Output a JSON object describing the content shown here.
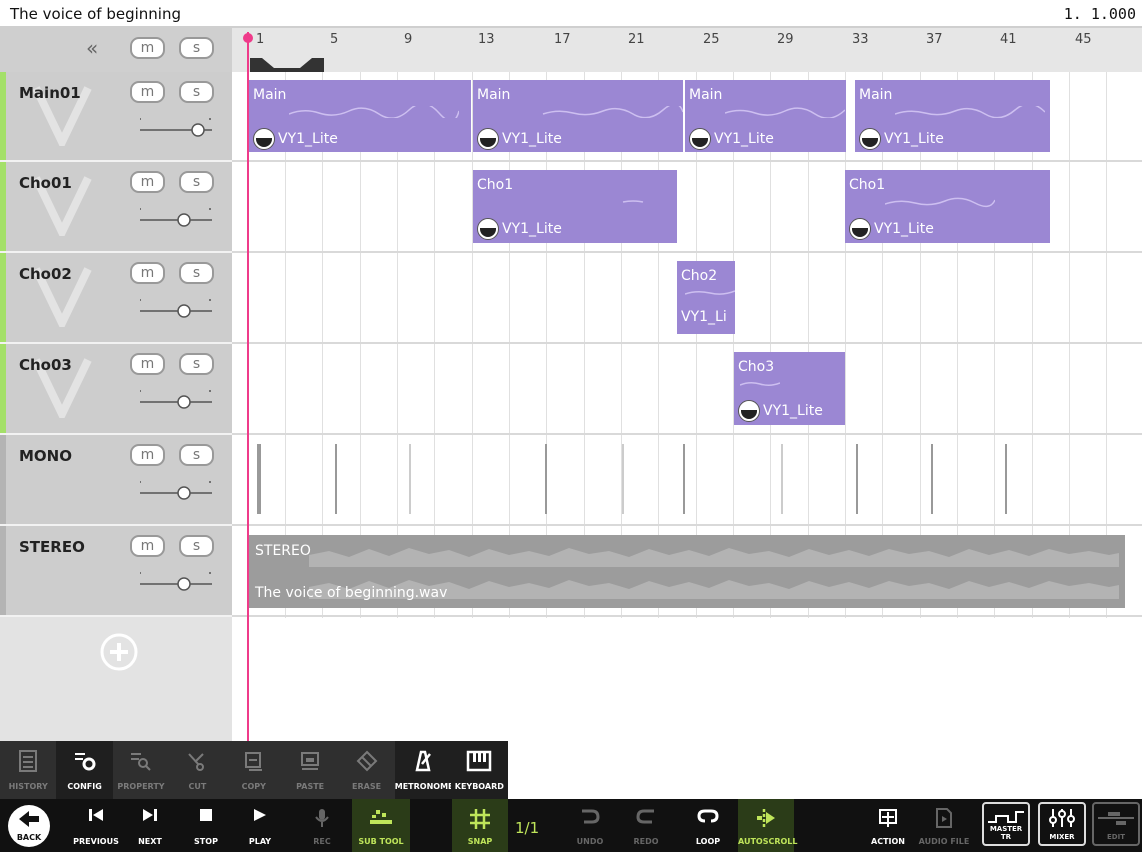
{
  "project": {
    "title": "The voice of beginning",
    "position": "1. 1.000"
  },
  "header": {
    "collapse_icon": "double-chevron-left-icon",
    "mute_label": "m",
    "solo_label": "s"
  },
  "ruler": {
    "bars": [
      "1",
      "5",
      "9",
      "13",
      "17",
      "21",
      "25",
      "29",
      "33",
      "37",
      "41",
      "45"
    ]
  },
  "tracks": [
    {
      "name": "Main01",
      "mute": "m",
      "solo": "s",
      "volume": 0.8,
      "kind": "vocal"
    },
    {
      "name": "Cho01",
      "mute": "m",
      "solo": "s",
      "volume": 0.6,
      "kind": "vocal"
    },
    {
      "name": "Cho02",
      "mute": "m",
      "solo": "s",
      "volume": 0.6,
      "kind": "vocal"
    },
    {
      "name": "Cho03",
      "mute": "m",
      "solo": "s",
      "volume": 0.6,
      "kind": "vocal"
    },
    {
      "name": "MONO",
      "mute": "m",
      "solo": "s",
      "volume": 0.6,
      "kind": "audio"
    },
    {
      "name": "STEREO",
      "mute": "m",
      "solo": "s",
      "volume": 0.6,
      "kind": "audio"
    }
  ],
  "clips": [
    {
      "track": "Main01",
      "name": "Main",
      "singer": "VY1_Lite"
    },
    {
      "track": "Main01",
      "name": "Main",
      "singer": "VY1_Lite"
    },
    {
      "track": "Main01",
      "name": "Main",
      "singer": "VY1_Lite"
    },
    {
      "track": "Main01",
      "name": "Main",
      "singer": "VY1_Lite"
    },
    {
      "track": "Cho01",
      "name": "Cho1",
      "singer": "VY1_Lite"
    },
    {
      "track": "Cho01",
      "name": "Cho1",
      "singer": "VY1_Lite"
    },
    {
      "track": "Cho02",
      "name": "Cho2",
      "singer": "VY1_Li"
    },
    {
      "track": "Cho03",
      "name": "Cho3",
      "singer": "VY1_Lite"
    }
  ],
  "audio_clip": {
    "track": "STEREO",
    "name": "STEREO",
    "file": "The voice of beginning.wav"
  },
  "sub_toolbar": [
    {
      "label": "HISTORY",
      "icon": "history-icon",
      "active": false
    },
    {
      "label": "CONFIG",
      "icon": "config-icon",
      "active": true
    },
    {
      "label": "PROPERTY",
      "icon": "property-icon",
      "active": false
    },
    {
      "label": "CUT",
      "icon": "scissors-icon",
      "active": false
    },
    {
      "label": "COPY",
      "icon": "copy-icon",
      "active": false
    },
    {
      "label": "PASTE",
      "icon": "paste-icon",
      "active": false
    },
    {
      "label": "ERASE",
      "icon": "eraser-icon",
      "active": false
    },
    {
      "label": "METRONOME",
      "icon": "metronome-icon",
      "active": true
    },
    {
      "label": "KEYBOARD",
      "icon": "keyboard-icon",
      "active": true
    }
  ],
  "main_toolbar": {
    "back": "BACK",
    "previous": "PREVIOUS",
    "next": "NEXT",
    "stop": "STOP",
    "play": "PLAY",
    "rec": "REC",
    "sub_tool": "SUB TOOL",
    "snap": "SNAP",
    "snap_value": "1/1",
    "undo": "UNDO",
    "redo": "REDO",
    "loop": "LOOP",
    "auto_scroll": "AUTOSCROLL",
    "action": "ACTION",
    "audio_file": "AUDIO FILE",
    "master_tr": "MASTER TR",
    "mixer": "MIXER",
    "edit": "EDIT"
  },
  "colors": {
    "vocal_clip": "#9b87d3",
    "audio_clip": "#9c9c9c",
    "playhead": "#ef3b8a",
    "track_strip": "#a4e069",
    "accent": "#bfe55a"
  }
}
